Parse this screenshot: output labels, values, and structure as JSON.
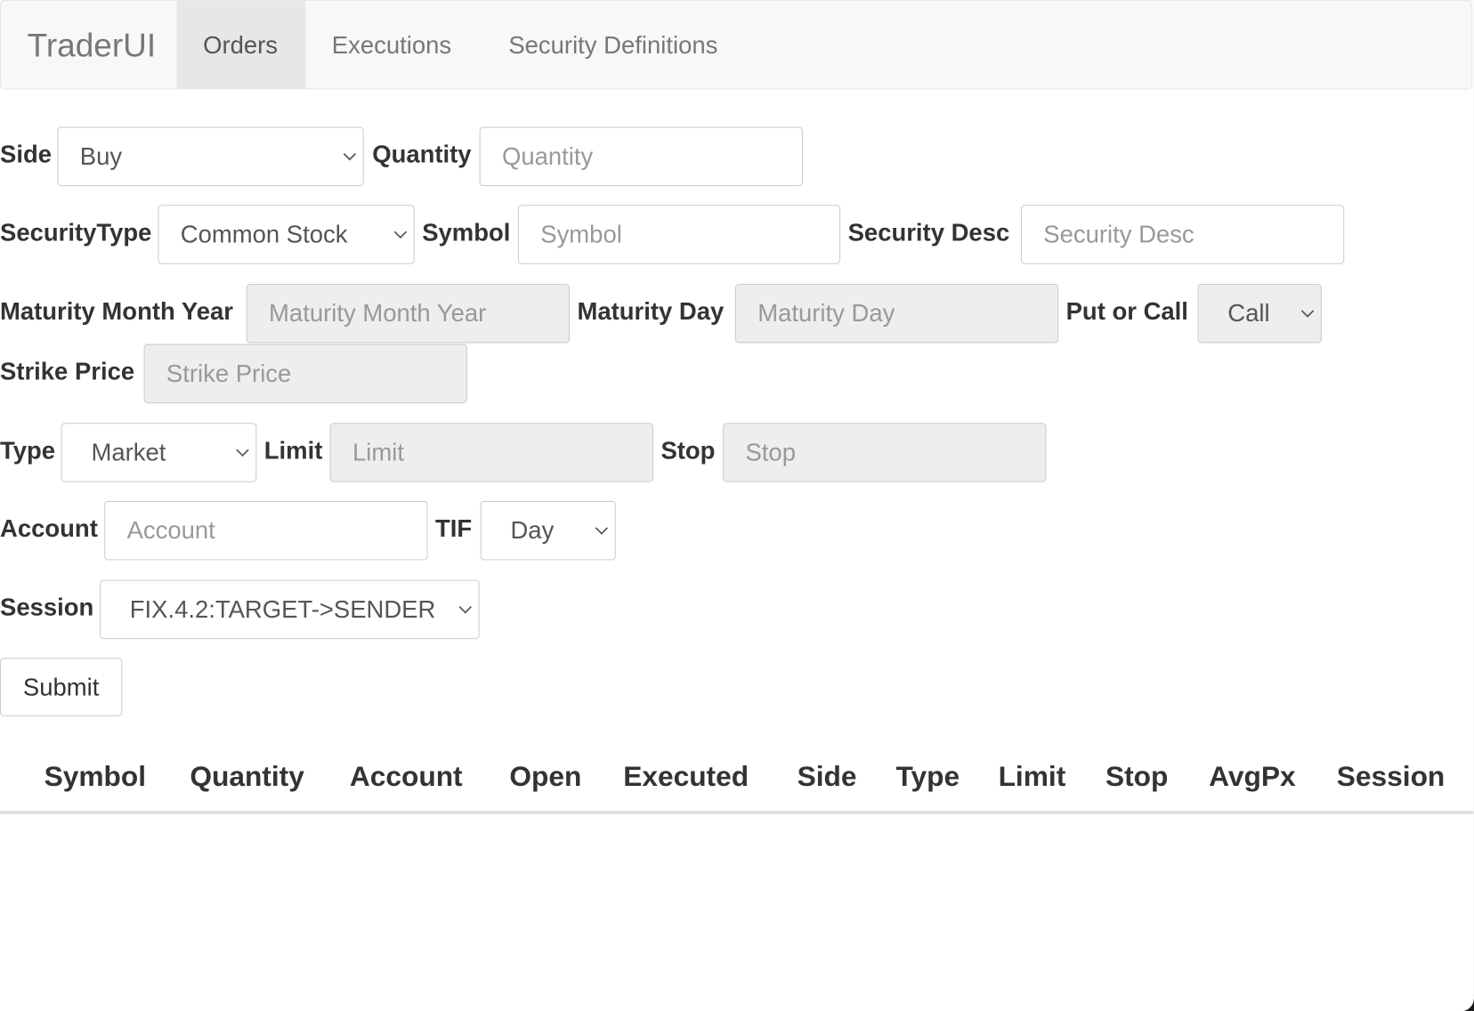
{
  "nav": {
    "brand": "TraderUI",
    "tabs": [
      {
        "label": "Orders",
        "active": true
      },
      {
        "label": "Executions"
      },
      {
        "label": "Security Definitions"
      }
    ]
  },
  "form": {
    "side": {
      "label": "Side",
      "value": "Buy"
    },
    "quantity": {
      "label": "Quantity",
      "placeholder": "Quantity"
    },
    "security_type": {
      "label": "SecurityType",
      "value": "Common Stock"
    },
    "symbol": {
      "label": "Symbol",
      "placeholder": "Symbol"
    },
    "security_desc": {
      "label": "Security Desc",
      "placeholder": "Security Desc"
    },
    "maturity_month_year": {
      "label": "Maturity Month Year",
      "placeholder": "Maturity Month Year"
    },
    "maturity_day": {
      "label": "Maturity Day",
      "placeholder": "Maturity Day"
    },
    "put_or_call": {
      "label": "Put or Call",
      "value": "Call"
    },
    "strike_price": {
      "label": "Strike Price",
      "placeholder": "Strike Price"
    },
    "type": {
      "label": "Type",
      "value": "Market"
    },
    "limit": {
      "label": "Limit",
      "placeholder": "Limit"
    },
    "stop": {
      "label": "Stop",
      "placeholder": "Stop"
    },
    "account": {
      "label": "Account",
      "placeholder": "Account"
    },
    "tif": {
      "label": "TIF",
      "value": "Day"
    },
    "session": {
      "label": "Session",
      "value": "FIX.4.2:TARGET->SENDER"
    },
    "submit": "Submit"
  },
  "table": {
    "headers": [
      "Symbol",
      "Quantity",
      "Account",
      "Open",
      "Executed",
      "Side",
      "Type",
      "Limit",
      "Stop",
      "AvgPx",
      "Session"
    ],
    "rows": []
  }
}
